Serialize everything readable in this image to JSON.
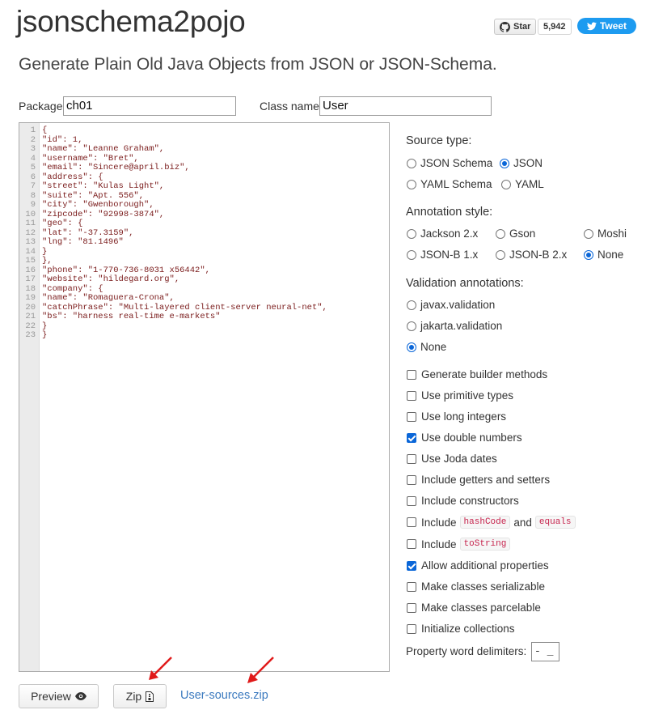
{
  "header": {
    "title": "jsonschema2pojo",
    "subtitle": "Generate Plain Old Java Objects from JSON or JSON-Schema.",
    "github_star_label": "Star",
    "github_star_count": "5,942",
    "tweet_label": "Tweet"
  },
  "form": {
    "package_label": "Package",
    "package_value": "ch01",
    "classname_label": "Class name",
    "classname_value": "User"
  },
  "editor": {
    "lines": [
      {
        "n": "1",
        "text": "{"
      },
      {
        "n": "2",
        "text": "\"id\": 1,"
      },
      {
        "n": "3",
        "text": "\"name\": \"Leanne Graham\","
      },
      {
        "n": "4",
        "text": "\"username\": \"Bret\","
      },
      {
        "n": "5",
        "text": "\"email\": \"Sincere@april.biz\","
      },
      {
        "n": "6",
        "text": "\"address\": {"
      },
      {
        "n": "7",
        "text": "\"street\": \"Kulas Light\","
      },
      {
        "n": "8",
        "text": "\"suite\": \"Apt. 556\","
      },
      {
        "n": "9",
        "text": "\"city\": \"Gwenborough\","
      },
      {
        "n": "10",
        "text": "\"zipcode\": \"92998-3874\","
      },
      {
        "n": "11",
        "text": "\"geo\": {"
      },
      {
        "n": "12",
        "text": "\"lat\": \"-37.3159\","
      },
      {
        "n": "13",
        "text": "\"lng\": \"81.1496\""
      },
      {
        "n": "14",
        "text": "}"
      },
      {
        "n": "15",
        "text": "},"
      },
      {
        "n": "16",
        "text": "\"phone\": \"1-770-736-8031 x56442\","
      },
      {
        "n": "17",
        "text": "\"website\": \"hildegard.org\","
      },
      {
        "n": "18",
        "text": "\"company\": {"
      },
      {
        "n": "19",
        "text": "\"name\": \"Romaguera-Crona\","
      },
      {
        "n": "20",
        "text": "\"catchPhrase\": \"Multi-layered client-server neural-net\","
      },
      {
        "n": "21",
        "text": "\"bs\": \"harness real-time e-markets\""
      },
      {
        "n": "22",
        "text": "}"
      },
      {
        "n": "23",
        "text": "}"
      }
    ]
  },
  "source_type": {
    "label": "Source type:",
    "options": [
      {
        "label": "JSON Schema",
        "selected": false
      },
      {
        "label": "JSON",
        "selected": true
      },
      {
        "label": "YAML Schema",
        "selected": false
      },
      {
        "label": "YAML",
        "selected": false
      }
    ]
  },
  "annotation_style": {
    "label": "Annotation style:",
    "options": [
      {
        "label": "Jackson 2.x",
        "selected": false
      },
      {
        "label": "Gson",
        "selected": false
      },
      {
        "label": "Moshi",
        "selected": false
      },
      {
        "label": "JSON-B 1.x",
        "selected": false
      },
      {
        "label": "JSON-B 2.x",
        "selected": false
      },
      {
        "label": "None",
        "selected": true
      }
    ]
  },
  "validation": {
    "label": "Validation annotations:",
    "options": [
      {
        "label": "javax.validation",
        "selected": false
      },
      {
        "label": "jakarta.validation",
        "selected": false
      },
      {
        "label": "None",
        "selected": true
      }
    ]
  },
  "checkboxes": [
    {
      "label": "Generate builder methods",
      "checked": false
    },
    {
      "label": "Use primitive types",
      "checked": false
    },
    {
      "label": "Use long integers",
      "checked": false
    },
    {
      "label": "Use double numbers",
      "checked": true
    },
    {
      "label": "Use Joda dates",
      "checked": false
    },
    {
      "label": "Include getters and setters",
      "checked": false
    },
    {
      "label": "Include constructors",
      "checked": false
    },
    {
      "label": "Include",
      "code1": "hashCode",
      "mid": "and",
      "code2": "equals",
      "checked": false
    },
    {
      "label": "Include",
      "code1": "toString",
      "checked": false
    },
    {
      "label": "Allow additional properties",
      "checked": true
    },
    {
      "label": "Make classes serializable",
      "checked": false
    },
    {
      "label": "Make classes parcelable",
      "checked": false
    },
    {
      "label": "Initialize collections",
      "checked": false
    }
  ],
  "delimiters": {
    "label": "Property word delimiters:",
    "value": "- _"
  },
  "actions": {
    "preview_label": "Preview",
    "zip_label": "Zip",
    "download_link": "User-sources.zip"
  },
  "colors": {
    "accent": "#0a66d8",
    "tweet": "#1d9bf0",
    "link": "#3b7abf",
    "code_string": "#7a1b1b",
    "arrow": "#e01a1a"
  }
}
